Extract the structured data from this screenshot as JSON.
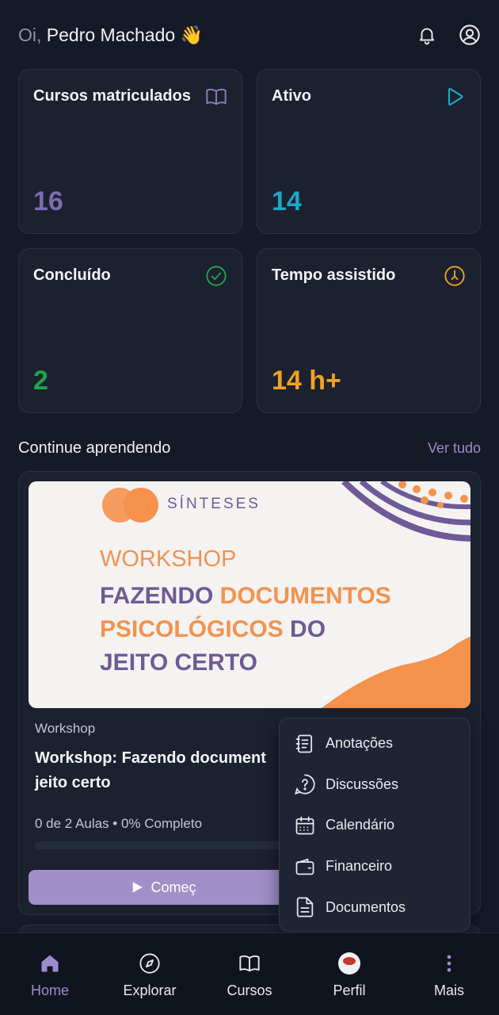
{
  "header": {
    "greeting_prefix": "Oi,",
    "user_name": "Pedro Machado",
    "wave_emoji": "👋",
    "bell_icon": "bell-icon",
    "profile_icon": "user-circle-icon"
  },
  "stats": [
    {
      "title": "Cursos matriculados",
      "value": "16",
      "icon": "book-open-icon",
      "color": "#7c6bb3"
    },
    {
      "title": "Ativo",
      "value": "14",
      "icon": "play-icon",
      "color": "#1ea7c9"
    },
    {
      "title": "Concluído",
      "value": "2",
      "icon": "check-circle-icon",
      "color": "#1fa54a"
    },
    {
      "title": "Tempo assistido",
      "value": "14 h+",
      "icon": "clock-icon",
      "color": "#f2a024"
    }
  ],
  "continue": {
    "section_title": "Continue aprendendo",
    "see_all": "Ver tudo"
  },
  "course": {
    "banner_brand": "SÍNTESES",
    "banner_tag": "WORKSHOP",
    "banner_line1_a": "FAZENDO ",
    "banner_line1_b": "DOCUMENTOS",
    "banner_line2_a": "PSICOLÓGICOS ",
    "banner_line2_b": "DO",
    "banner_line3": "JEITO CERTO",
    "category": "Workshop",
    "title": "Workshop: Fazendo document jeito certo",
    "progress_text": "0 de 2 Aulas • 0% Completo",
    "progress": 0,
    "start_label": "Começ"
  },
  "menu": [
    {
      "label": "Anotações",
      "icon": "notes-icon"
    },
    {
      "label": "Discussões",
      "icon": "question-circle-icon"
    },
    {
      "label": "Calendário",
      "icon": "calendar-icon"
    },
    {
      "label": "Financeiro",
      "icon": "wallet-icon"
    },
    {
      "label": "Documentos",
      "icon": "document-icon"
    }
  ],
  "nav": [
    {
      "label": "Home",
      "icon": "home-icon",
      "active": true
    },
    {
      "label": "Explorar",
      "icon": "compass-icon",
      "active": false
    },
    {
      "label": "Cursos",
      "icon": "book-open-icon",
      "active": false
    },
    {
      "label": "Perfil",
      "icon": "avatar",
      "active": false
    },
    {
      "label": "Mais",
      "icon": "more-vertical-icon",
      "active": false
    }
  ],
  "colors": {
    "accent": "#9d8bd0",
    "banner_purple": "#6e5a96",
    "banner_orange": "#f5924e"
  }
}
